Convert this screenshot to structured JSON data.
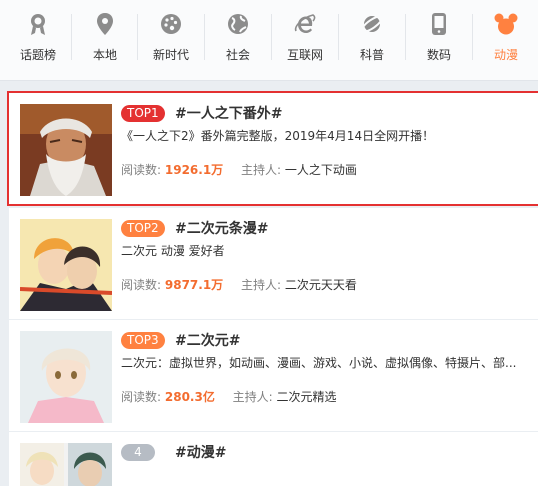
{
  "nav": {
    "items": [
      {
        "label": "话题榜",
        "icon": "medal-icon"
      },
      {
        "label": "本地",
        "icon": "location-pin-icon"
      },
      {
        "label": "新时代",
        "icon": "palette-icon"
      },
      {
        "label": "社会",
        "icon": "globe-icon"
      },
      {
        "label": "互联网",
        "icon": "ie-browser-icon"
      },
      {
        "label": "科普",
        "icon": "planet-icon"
      },
      {
        "label": "数码",
        "icon": "phone-icon"
      },
      {
        "label": "动漫",
        "icon": "mickey-icon",
        "active": true
      }
    ]
  },
  "colors": {
    "accent": "#ff8140",
    "top1": "#e43131",
    "top23": "#ff8140",
    "rank_other": "#b6bcc4",
    "highlight_border": "#e43131",
    "read_num": "#f36c2f"
  },
  "topics": [
    {
      "rank": "TOP1",
      "title": "#一人之下番外#",
      "desc": "《一人之下2》番外篇完整版，2019年4月14日全网开播！",
      "read_label": "阅读数:",
      "reads": "1926.1万",
      "host_label": "主持人:",
      "host": "一人之下动画"
    },
    {
      "rank": "TOP2",
      "title": "#二次元条漫#",
      "desc": "二次元 动漫 爱好者",
      "read_label": "阅读数:",
      "reads": "9877.1万",
      "host_label": "主持人:",
      "host": "二次元天天看"
    },
    {
      "rank": "TOP3",
      "title": "#二次元#",
      "desc": "二次元：虚拟世界，如动画、漫画、游戏、小说、虚拟偶像、特摄片、部...",
      "read_label": "阅读数:",
      "reads": "280.3亿",
      "host_label": "主持人:",
      "host": "二次元精选"
    },
    {
      "rank": "4",
      "title": "#动漫#"
    }
  ]
}
